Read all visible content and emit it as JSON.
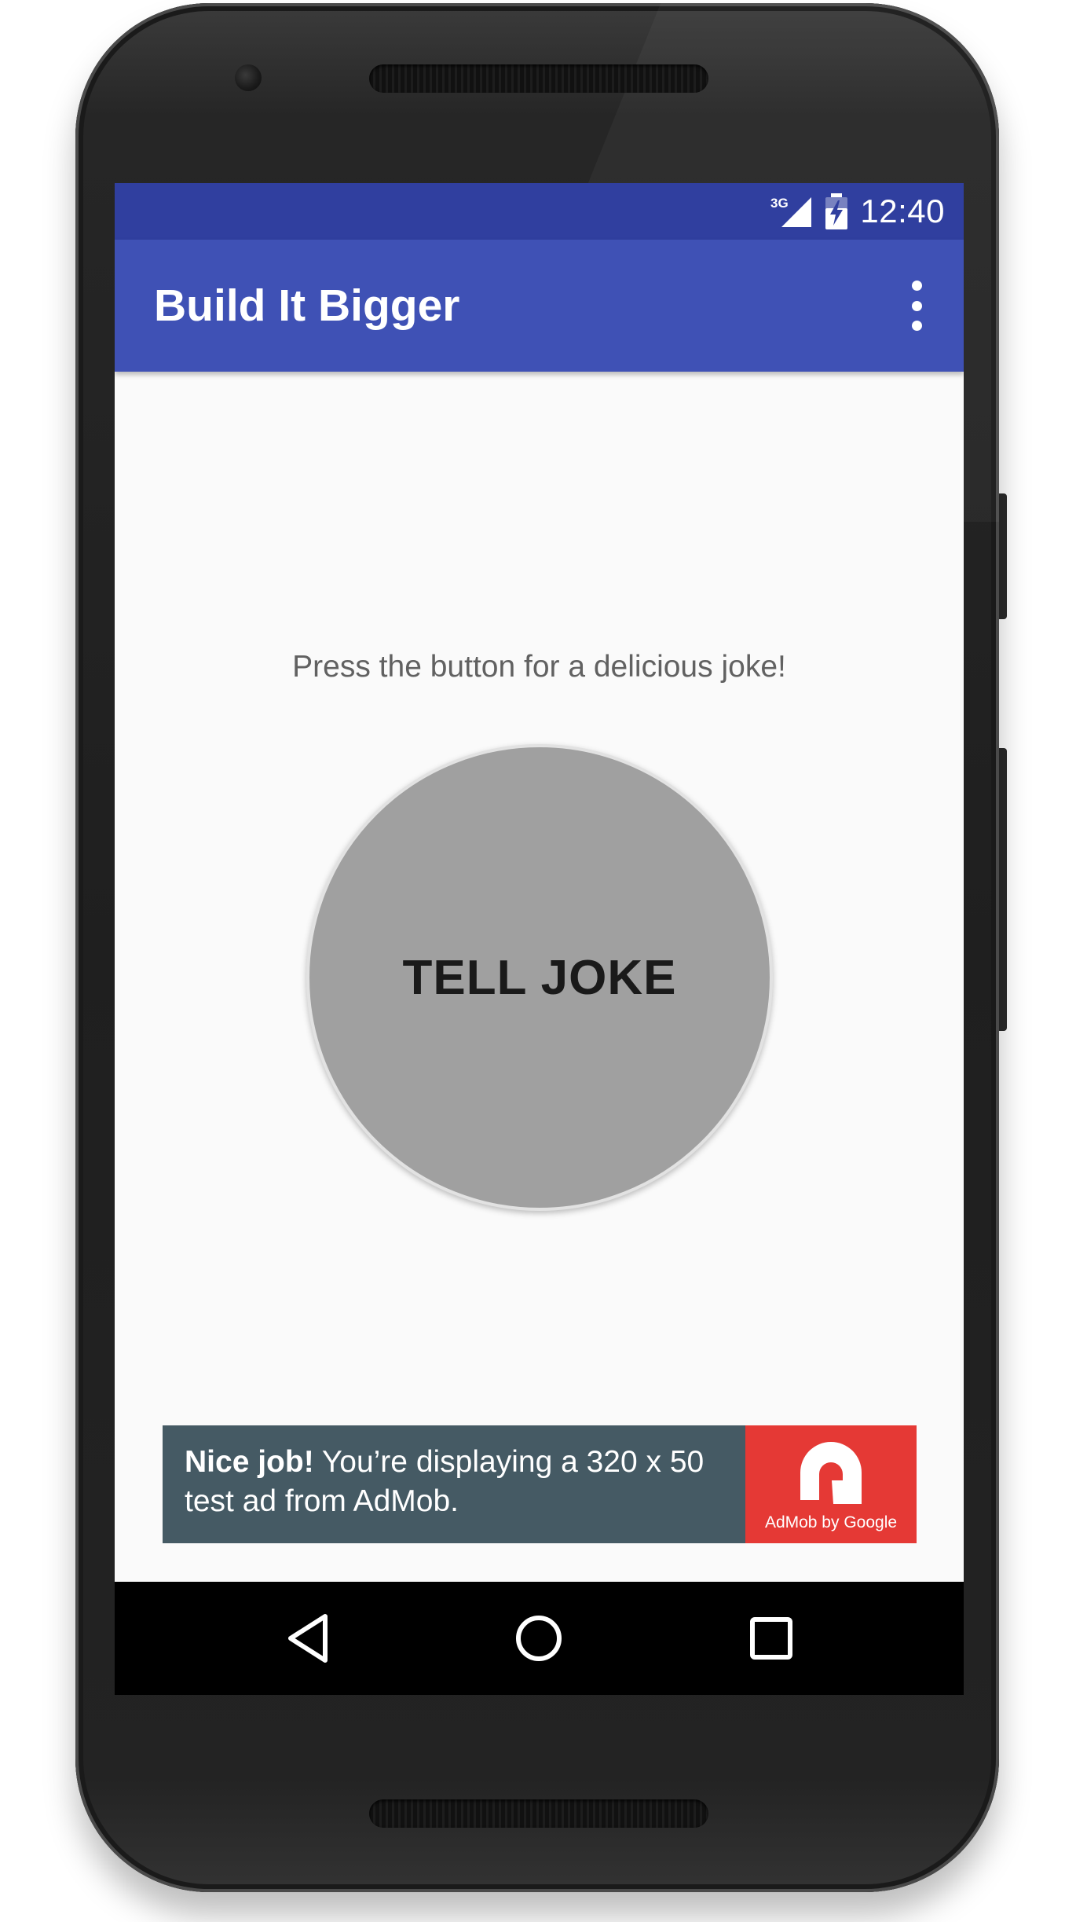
{
  "status_bar": {
    "network": "3G",
    "time": "12:40"
  },
  "app_bar": {
    "title": "Build It Bigger",
    "overflow_icon": "more-vert-icon"
  },
  "main": {
    "prompt": "Press the button for a delicious joke!",
    "button_label": "TELL JOKE"
  },
  "ad": {
    "headline": "Nice job!",
    "body": "You’re displaying a 320 x 50 test ad from AdMob.",
    "logo_caption": "AdMob by Google",
    "colors": {
      "background": "#455a64",
      "logo": "#e53935"
    }
  },
  "nav_bar": {
    "icons": [
      "back-icon",
      "home-icon",
      "recents-icon"
    ]
  },
  "colors": {
    "primary": "#3f51b5",
    "primary_dark": "#303f9f",
    "button": "#a0a0a0"
  }
}
